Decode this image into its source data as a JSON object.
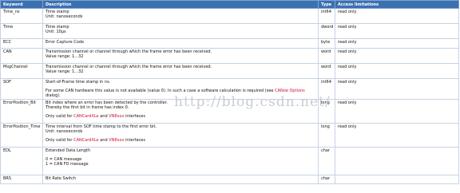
{
  "headers": {
    "keyword": "Keyword",
    "description": "Description",
    "type": "Type",
    "access": "Access limitations"
  },
  "rows": [
    {
      "keyword": "Time_ns",
      "desc": [
        "Time stamp",
        "Unit: nanoseconds"
      ],
      "type": "int64",
      "access": "read only"
    },
    {
      "keyword": "Time",
      "desc": [
        "Time stamp",
        "Unit: 10µs"
      ],
      "type": "dword",
      "access": "read only"
    },
    {
      "keyword": "ECC",
      "desc": [
        "Error Capture Code"
      ],
      "type": "byte",
      "access": "read only"
    },
    {
      "keyword": "CAN",
      "desc": [
        "Transmission channel or channel through which the frame error has been received.",
        "Value range: 1...32"
      ],
      "type": "word",
      "access": "read only"
    },
    {
      "keyword": "MsgChannel",
      "desc": [
        "Transmission channel or channel through which the frame error has been received.",
        "Value range: 1...32"
      ],
      "type": "word",
      "access": "read only"
    },
    {
      "keyword": "SOF",
      "desc_sof_1": "Start-of-Frame time stamp in ns.",
      "desc_sof_2a": "For some CAN hardware this value is not available (value 0). In such a case a software calculation is required (see ",
      "desc_sof_link": "CANoe Options",
      "desc_sof_2b": " dialog).",
      "type": "int64",
      "access": "read only"
    },
    {
      "keyword": "ErrorPosition_Bit",
      "desc": [
        "Bit index where an error has been detected by the controller.",
        "Thereby the first bit in frame has index 0."
      ],
      "only_pre": "Only valid for ",
      "link1": "CANCardXLe",
      "and": " and ",
      "link2": "VN8xxx",
      "only_post": " interfaces",
      "type": "long",
      "access": "read only"
    },
    {
      "keyword": "ErrorPosition_Time",
      "desc": [
        "Time interval from SOF time stamp to the first error bit.",
        "Unit: nanoseconds"
      ],
      "only_pre": "Only valid for ",
      "link1": "CANCardXLe",
      "and": " and ",
      "link2": "VN8xxx",
      "only_post": " interfaces",
      "type": "long",
      "access": "read only"
    },
    {
      "keyword": "EDL",
      "desc_edl_1": "Extended Data Length",
      "desc_edl_2": "0 = CAN message",
      "desc_edl_3": "1 = CAN FD message",
      "type": "char",
      "access": ""
    },
    {
      "keyword": "BRS",
      "desc": [
        "Bit Rate Switch"
      ],
      "type": "char",
      "access": ""
    }
  ],
  "watermark": "http://blog.csdn.net/"
}
